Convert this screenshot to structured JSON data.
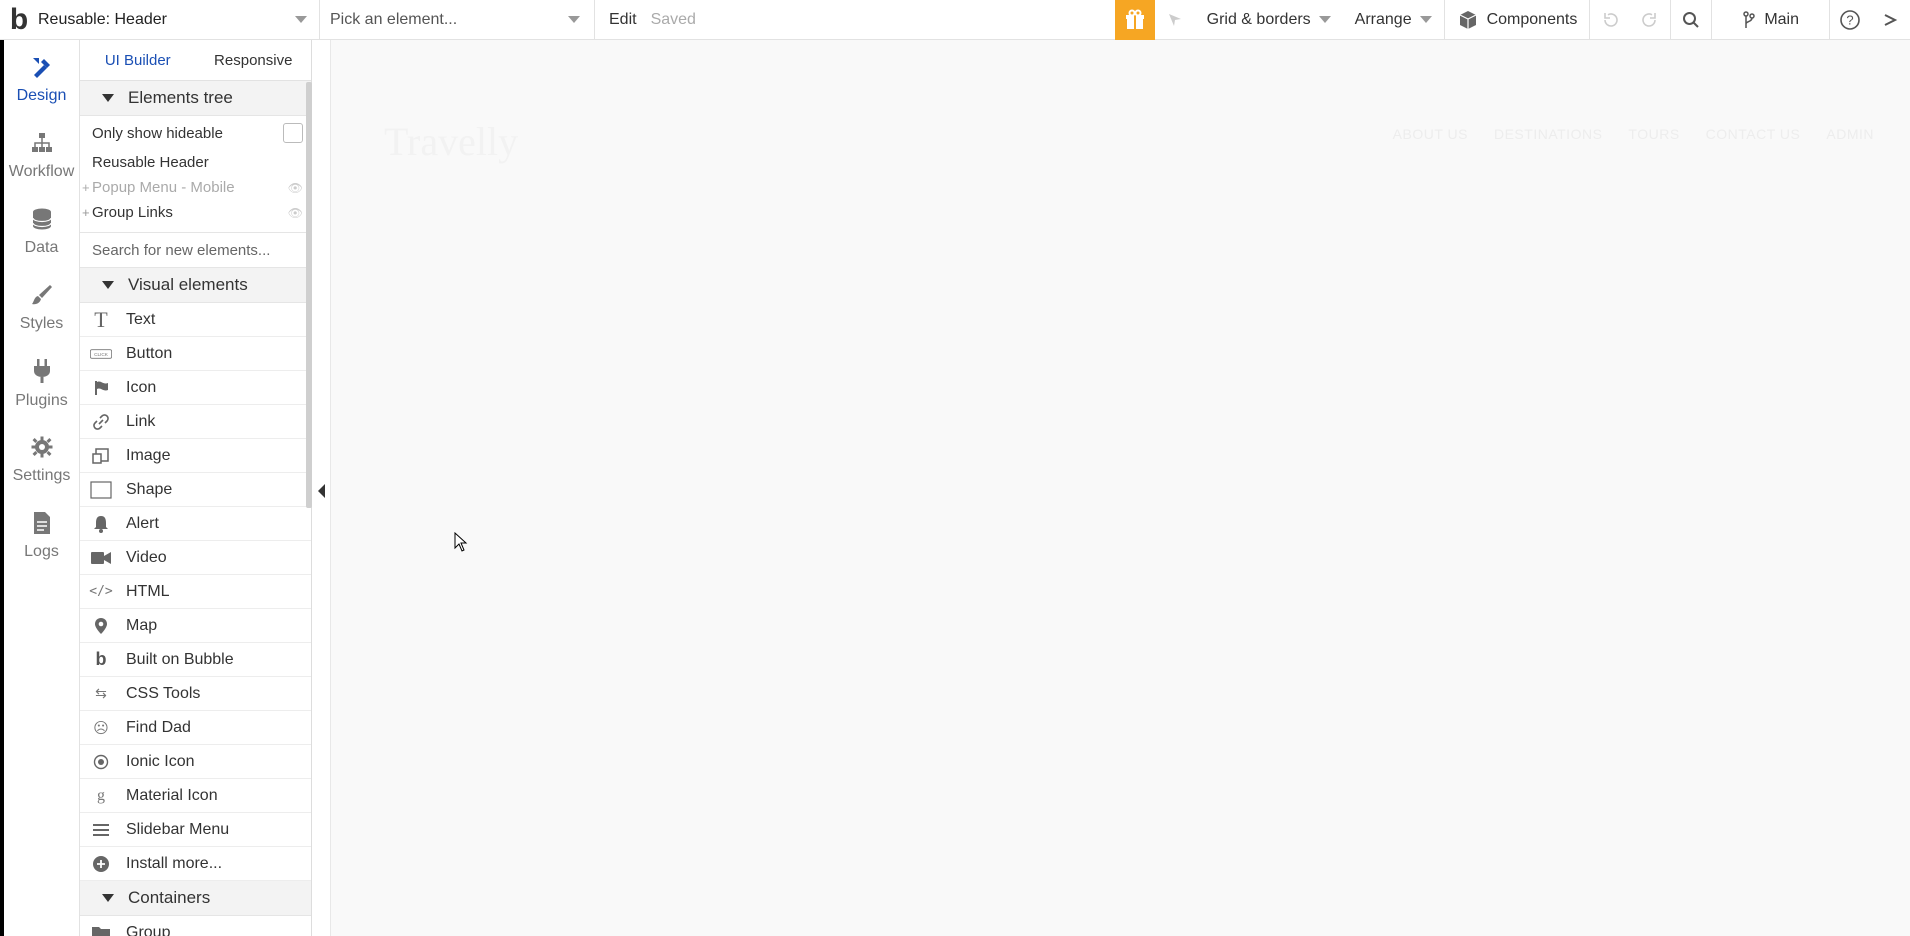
{
  "topbar": {
    "page_name": "Reusable: Header",
    "pick_placeholder": "Pick an element...",
    "edit_label": "Edit",
    "saved_label": "Saved",
    "grid_label": "Grid & borders",
    "arrange_label": "Arrange",
    "components_label": "Components",
    "branch_label": "Main",
    "accent_color": "#f6a623"
  },
  "leftnav": [
    {
      "label": "Design",
      "icon": "design-icon"
    },
    {
      "label": "Workflow",
      "icon": "workflow-icon"
    },
    {
      "label": "Data",
      "icon": "database-icon"
    },
    {
      "label": "Styles",
      "icon": "brush-icon"
    },
    {
      "label": "Plugins",
      "icon": "plug-icon"
    },
    {
      "label": "Settings",
      "icon": "gear-icon"
    },
    {
      "label": "Logs",
      "icon": "document-icon"
    }
  ],
  "panel": {
    "tabs": [
      "UI Builder",
      "Responsive"
    ],
    "elements_tree_title": "Elements tree",
    "only_hideable_label": "Only show hideable",
    "tree": [
      "Reusable Header",
      "Popup Menu - Mobile",
      "Group Links"
    ],
    "search_placeholder": "Search for new elements...",
    "visual_title": "Visual elements",
    "visual_elements": [
      "Text",
      "Button",
      "Icon",
      "Link",
      "Image",
      "Shape",
      "Alert",
      "Video",
      "HTML",
      "Map",
      "Built on Bubble",
      "CSS Tools",
      "Find Dad",
      "Ionic Icon",
      "Material Icon",
      "Slidebar Menu",
      "Install more..."
    ],
    "containers_title": "Containers",
    "containers": [
      "Group"
    ]
  },
  "canvas": {
    "brand": "Travelly",
    "links": [
      "ABOUT US",
      "DESTINATIONS",
      "TOURS",
      "CONTACT US",
      "ADMIN"
    ]
  }
}
